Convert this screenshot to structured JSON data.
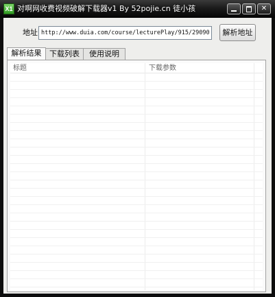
{
  "window": {
    "title": "对啊网收费视频破解下载器v1 By 52pojie.cn 徒小孩",
    "icon_text": "X1",
    "controls": {
      "minimize": "",
      "maximize": "",
      "close": "✕"
    }
  },
  "address": {
    "label": "地址",
    "value": "http://www.duia.com/course/lecturePlay/915/29090",
    "parse_button": "解析地址"
  },
  "tabs": [
    {
      "label": "解析结果",
      "active": true
    },
    {
      "label": "下载列表",
      "active": false
    },
    {
      "label": "使用说明",
      "active": false
    }
  ],
  "table": {
    "columns": [
      "标题",
      "下载参数"
    ],
    "rows": []
  },
  "colors": {
    "titlebar": "#050505",
    "client_bg": "#eeeeec",
    "icon_green": "#2f9a22"
  }
}
